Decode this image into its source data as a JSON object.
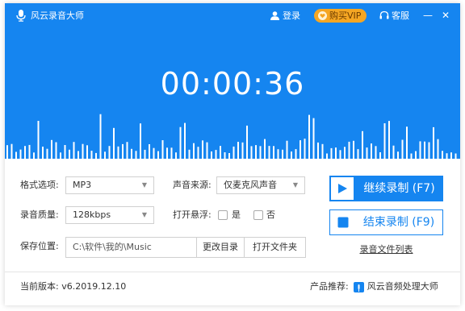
{
  "window": {
    "app_title": "风云录音大师",
    "login_label": "登录",
    "vip_label": "购买VIP",
    "support_label": "客服",
    "minimize_glyph": "—",
    "close_glyph": "✕"
  },
  "timer": {
    "display": "00:00:36"
  },
  "settings": {
    "format_label": "格式选项:",
    "format_value": "MP3",
    "source_label": "声音来源:",
    "source_value": "仅麦克风声音",
    "quality_label": "录音质量:",
    "quality_value": "128kbps",
    "float_label": "打开悬浮:",
    "yes_label": "是",
    "no_label": "否",
    "save_label": "保存位置:",
    "save_path": "C:\\软件\\我的\\Music",
    "change_dir_label": "更改目录",
    "open_folder_label": "打开文件夹"
  },
  "actions": {
    "continue_label": "继续录制 (F7)",
    "end_label": "结束录制 (F9)",
    "file_list_label": "录音文件列表"
  },
  "footer": {
    "version_label": "当前版本:",
    "version_value": "v6.2019.12.10",
    "recommend_label": "产品推荐:",
    "recommend_product": "风云音频处理大师"
  },
  "colors": {
    "brand_blue": "#1585f0",
    "vip_orange": "#f5a623"
  },
  "icons": {
    "app": "microphone-icon",
    "user": "user-icon",
    "vip": "heart-icon",
    "support": "headset-icon",
    "play": "play-icon",
    "stop": "stop-icon",
    "product": "audio-app-icon"
  }
}
